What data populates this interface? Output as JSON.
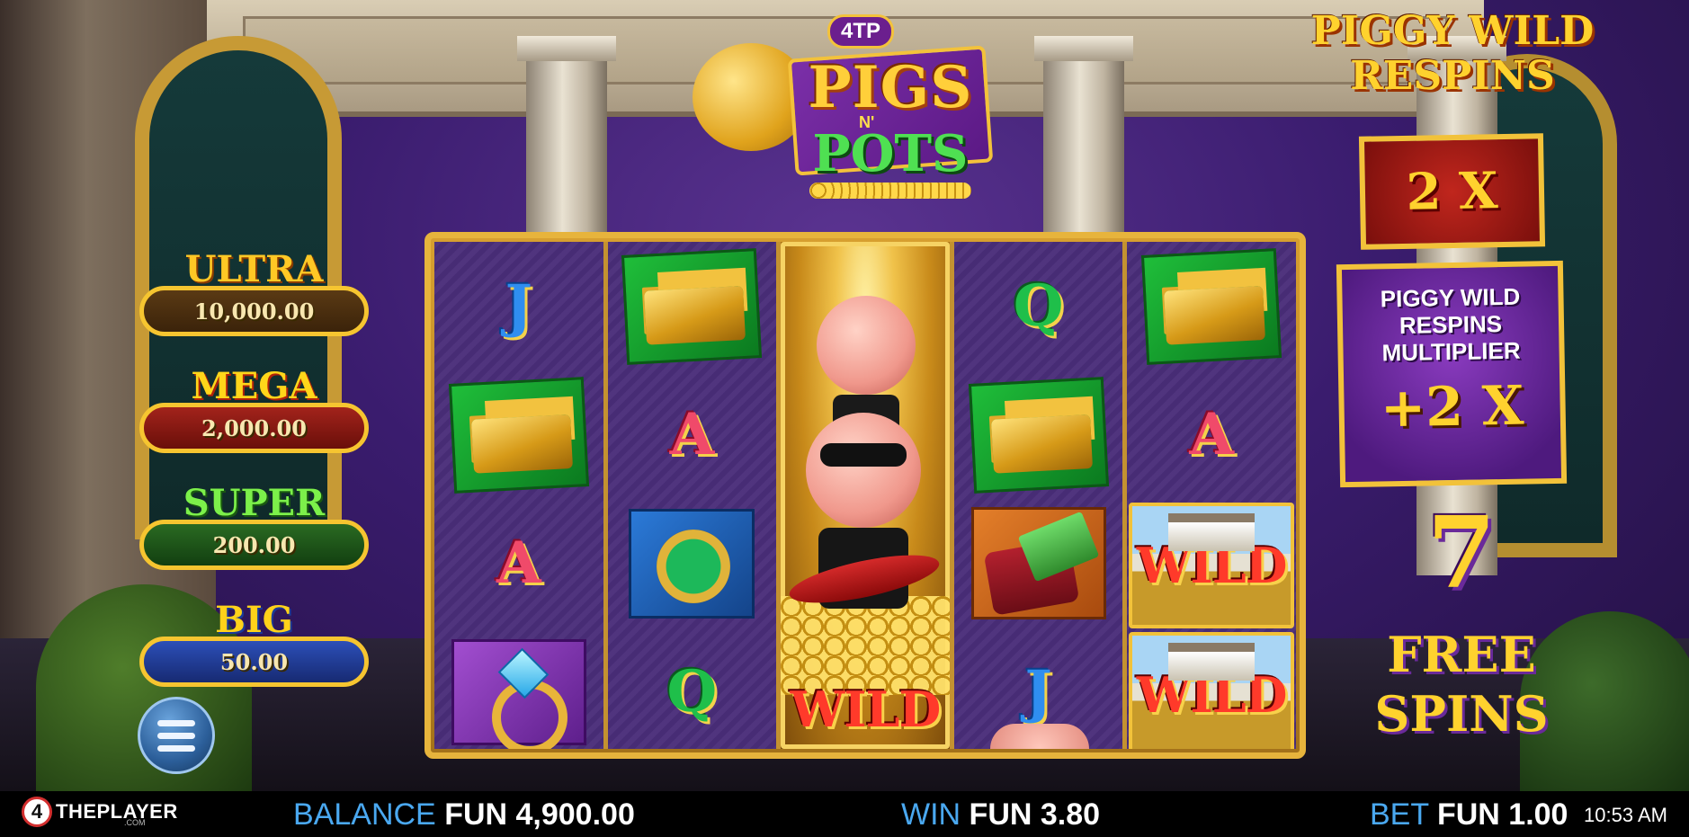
{
  "logo": {
    "badge": "4TP",
    "title_top": "PIGS",
    "title_mid": "N'",
    "title_bottom": "POTS"
  },
  "jackpots": [
    {
      "name": "ULTRA",
      "value": "10,000.00"
    },
    {
      "name": "MEGA",
      "value": "2,000.00"
    },
    {
      "name": "SUPER",
      "value": "200.00"
    },
    {
      "name": "BIG",
      "value": "50.00"
    }
  ],
  "reels": [
    [
      "J",
      "gold-bars",
      "A",
      "diamond-ring"
    ],
    [
      "gold-bars",
      "A",
      "watch",
      "Q"
    ],
    [
      "pig-wild-feature"
    ],
    [
      "Q",
      "gold-bars",
      "wallet",
      "J"
    ],
    [
      "gold-bars",
      "A",
      "WILD",
      "WILD"
    ]
  ],
  "wild_label": "WILD",
  "right_panel": {
    "feature_title_line1": "PIGGY WILD",
    "feature_title_line2": "RESPINS",
    "multiplier": "2 X",
    "respin_label_line1": "PIGGY WILD",
    "respin_label_line2": "RESPINS",
    "respin_label_line3": "MULTIPLIER",
    "respin_multiplier": "+2 X",
    "free_spins_count": "7",
    "free_spins_line1": "FREE",
    "free_spins_line2": "SPINS"
  },
  "bottom_bar": {
    "brand_mark": "4",
    "brand_text": "THEPLAYER",
    "brand_sub": ".COM",
    "balance_label": "BALANCE",
    "balance_value": "FUN 4,900.00",
    "win_label": "WIN",
    "win_value": "FUN 3.80",
    "bet_label": "BET",
    "bet_value": "FUN 1.00",
    "clock": "10:53 AM"
  },
  "colors": {
    "accent_gold": "#f2c23a",
    "label_blue": "#4aa8f0",
    "bar_bg": "#000000"
  }
}
